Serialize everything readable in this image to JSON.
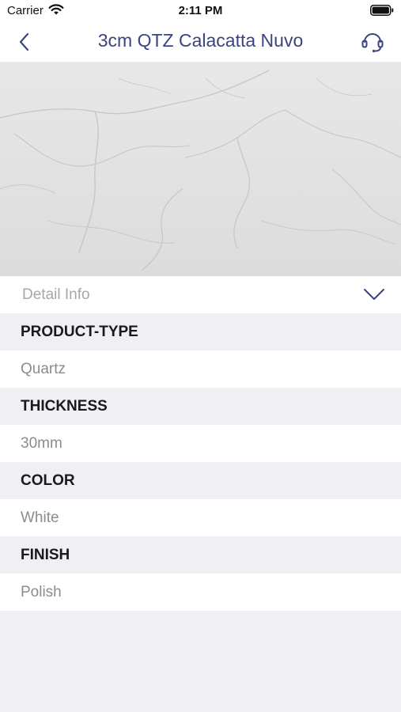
{
  "status_bar": {
    "carrier": "Carrier",
    "time": "2:11 PM"
  },
  "nav": {
    "title": "3cm QTZ Calacatta Nuvo",
    "back_icon": "chevron-left-icon",
    "support_icon": "headset-icon",
    "accent_color": "#3a4480"
  },
  "detail": {
    "header_label": "Detail Info",
    "toggle_icon": "chevron-down-icon",
    "specs": [
      {
        "key": "PRODUCT-TYPE",
        "value": "Quartz"
      },
      {
        "key": "THICKNESS",
        "value": "30mm"
      },
      {
        "key": "COLOR",
        "value": "White"
      },
      {
        "key": "FINISH",
        "value": "Polish"
      }
    ]
  }
}
